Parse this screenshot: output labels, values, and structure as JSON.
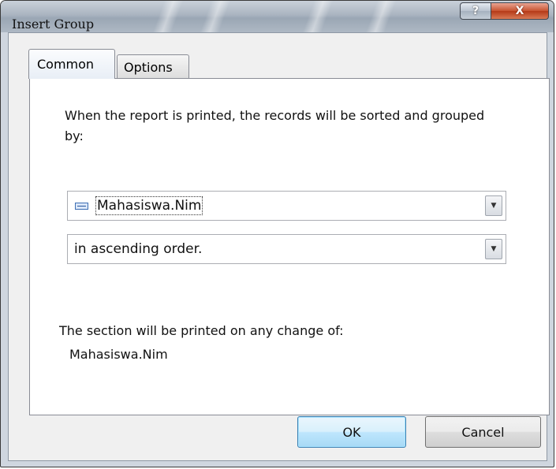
{
  "window": {
    "title": "Insert Group",
    "help_glyph": "?",
    "close_glyph": "X"
  },
  "tabs": [
    {
      "label": "Common",
      "active": true
    },
    {
      "label": "Options",
      "active": false
    }
  ],
  "common": {
    "description": "When the report is printed, the records will be sorted and grouped by:",
    "group_field": {
      "value": "Mahasiswa.Nim",
      "icon": "database-field-icon"
    },
    "sort_order": {
      "value": "in ascending order."
    },
    "dropdown_glyph": "▼",
    "section_label": "The section will be printed on any change of:",
    "section_value": "Mahasiswa.Nim"
  },
  "buttons": {
    "ok": "OK",
    "cancel": "Cancel"
  },
  "colors": {
    "accent_ok_border": "#3c7fb1",
    "close_button": "#c7522f"
  }
}
